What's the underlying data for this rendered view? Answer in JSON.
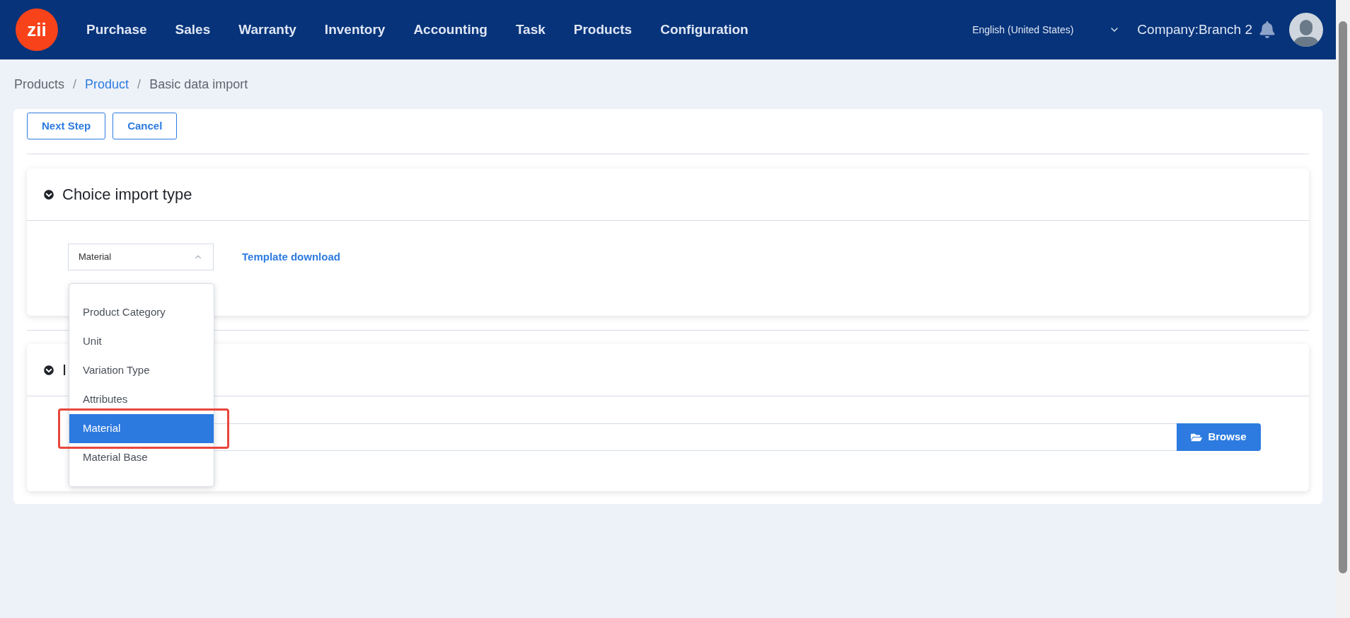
{
  "header": {
    "logo": "zii",
    "menu": [
      {
        "label": "Purchase"
      },
      {
        "label": "Sales"
      },
      {
        "label": "Warranty"
      },
      {
        "label": "Inventory"
      },
      {
        "label": "Accounting"
      },
      {
        "label": "Task"
      },
      {
        "label": "Products"
      },
      {
        "label": "Configuration"
      }
    ],
    "language": "English (United States)",
    "company": "Company:Branch 2"
  },
  "breadcrumb_separator": "/",
  "breadcrumb": [
    {
      "label": "Products",
      "kind": "plain"
    },
    {
      "label": "Product",
      "kind": "link"
    },
    {
      "label": "Basic data import",
      "kind": "current"
    }
  ],
  "actions": [
    "Next Step",
    "Cancel"
  ],
  "import_type": {
    "title": "Choice import type",
    "select": {
      "value": "Material",
      "expanded": true,
      "options": [
        {
          "label": "Product Category",
          "selected": false
        },
        {
          "label": "Unit",
          "selected": false
        },
        {
          "label": "Variation Type",
          "selected": false
        },
        {
          "label": "Attributes",
          "selected": false
        },
        {
          "label": "Material",
          "selected": true
        },
        {
          "label": "Material Base",
          "selected": false
        }
      ]
    },
    "link": "Template download"
  },
  "upload": {
    "title": "I",
    "button": "Browse"
  }
}
